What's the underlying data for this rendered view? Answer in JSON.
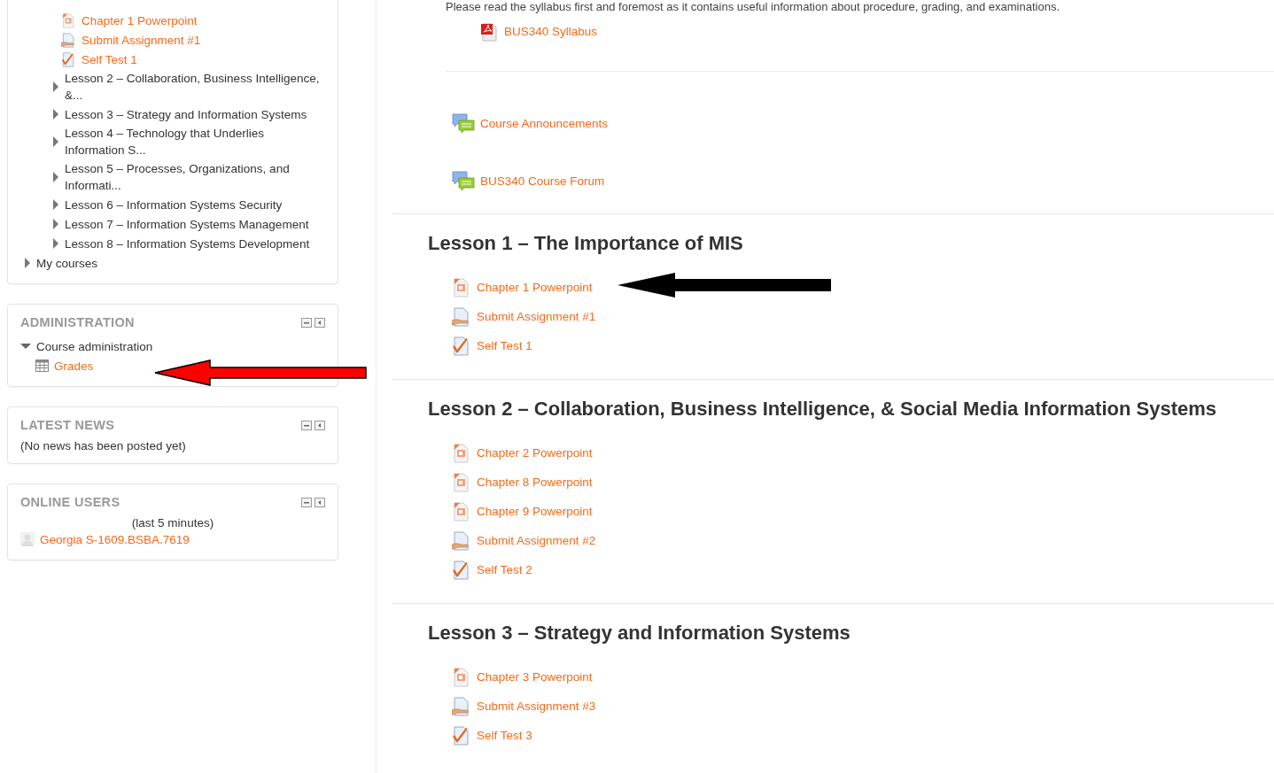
{
  "navigation": {
    "course_items": [
      {
        "kind": "powerpoint",
        "label": "Chapter 1 Powerpoint"
      },
      {
        "kind": "assignment",
        "label": "Submit Assignment #1"
      },
      {
        "kind": "quiz",
        "label": "Self Test 1"
      },
      {
        "kind": "node",
        "label": "Lesson 2 – Collaboration, Business Intelligence, &...",
        "expanded": false
      },
      {
        "kind": "node",
        "label": "Lesson 3 – Strategy and Information Systems",
        "expanded": false
      },
      {
        "kind": "node",
        "label": "Lesson 4 – Technology that Underlies Information S...",
        "expanded": false
      },
      {
        "kind": "node",
        "label": "Lesson 5 – Processes, Organizations, and Informati...",
        "expanded": false
      },
      {
        "kind": "node",
        "label": "Lesson 6 – Information Systems Security",
        "expanded": false
      },
      {
        "kind": "node",
        "label": "Lesson 7 – Information Systems Management",
        "expanded": false
      },
      {
        "kind": "node",
        "label": "Lesson 8 – Information Systems Development",
        "expanded": false
      }
    ],
    "root_items": [
      {
        "label": "My courses",
        "expanded": false
      }
    ]
  },
  "administration": {
    "title": "ADMINISTRATION",
    "items": [
      {
        "label": "Course administration",
        "expanded": true,
        "children": [
          {
            "kind": "grades",
            "label": "Grades"
          }
        ]
      }
    ]
  },
  "latest_news": {
    "title": "LATEST NEWS",
    "text": "(No news has been posted yet)"
  },
  "online_users": {
    "title": "ONLINE USERS",
    "period": "(last 5 minutes)",
    "users": [
      "Georgia S-1609.BSBA.7619"
    ]
  },
  "intro": {
    "text": "Please read the syllabus first and foremost as it contains useful information about procedure, grading, and examinations.",
    "resources": [
      {
        "kind": "pdf",
        "label": "BUS340 Syllabus"
      }
    ]
  },
  "forums": [
    {
      "kind": "forum",
      "label": "Course Announcements"
    },
    {
      "kind": "forum",
      "label": "BUS340 Course Forum"
    }
  ],
  "lessons": [
    {
      "title": "Lesson 1 – The Importance of MIS",
      "resources": [
        {
          "kind": "powerpoint",
          "label": "Chapter 1 Powerpoint"
        },
        {
          "kind": "assignment",
          "label": "Submit Assignment #1"
        },
        {
          "kind": "quiz",
          "label": "Self Test 1"
        }
      ]
    },
    {
      "title": "Lesson 2 – Collaboration, Business Intelligence, & Social Media Information Systems",
      "resources": [
        {
          "kind": "powerpoint",
          "label": "Chapter 2 Powerpoint"
        },
        {
          "kind": "powerpoint",
          "label": "Chapter 8 Powerpoint"
        },
        {
          "kind": "powerpoint",
          "label": "Chapter 9 Powerpoint"
        },
        {
          "kind": "assignment",
          "label": "Submit Assignment #2"
        },
        {
          "kind": "quiz",
          "label": "Self Test 2"
        }
      ]
    },
    {
      "title": "Lesson 3 – Strategy and Information Systems",
      "resources": [
        {
          "kind": "powerpoint",
          "label": "Chapter 3 Powerpoint"
        },
        {
          "kind": "assignment",
          "label": "Submit Assignment #3"
        },
        {
          "kind": "quiz",
          "label": "Self Test 3"
        }
      ]
    }
  ]
}
